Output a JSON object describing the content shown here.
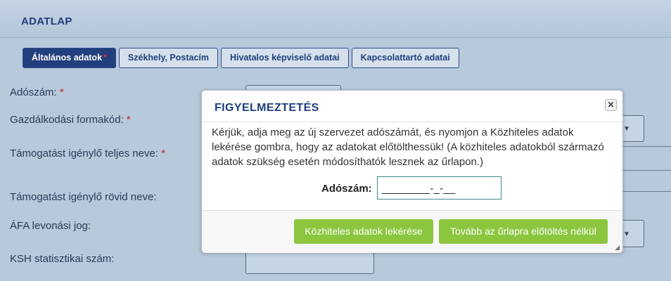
{
  "header": {
    "title": "ADATLAP"
  },
  "tabs": [
    {
      "label": "Általános adatok",
      "required": "*"
    },
    {
      "label": "Székhely, Postacím"
    },
    {
      "label": "Hivatalos képviselő adatai"
    },
    {
      "label": "Kapcsolattartó adatai"
    }
  ],
  "form": {
    "required_mark": "*",
    "fields": [
      {
        "label": "Adószám:"
      },
      {
        "label": "Gazdálkodási formakód:"
      },
      {
        "label": "Támogatást igénylő teljes neve:"
      },
      {
        "label": "Támogatást igénylő rövid neve:"
      },
      {
        "label": "ÁFA levonási jog:"
      },
      {
        "label": "KSH statisztikai szám:"
      }
    ]
  },
  "modal": {
    "title": "FIGYELMEZTETÉS",
    "close_icon": "close-icon",
    "message": "Kérjük, adja meg az új szervezet adószámát, és nyomjon a Közhiteles adatok lekérése gombra, hogy az adatokat előtölthessük! (A közhiteles adatokból származó adatok szükség esetén módosíthatók lesznek az űrlapon.)",
    "tax_label": "Adószám:",
    "tax_value": "",
    "tax_mask": "________-_-__",
    "buttons": {
      "fetch": "Közhiteles adatok lekérése",
      "skip": "Tovább az űrlapra előtöltés nélkül"
    }
  },
  "colors": {
    "accent": "#213f7c",
    "button_green": "#8cc63f",
    "required": "#c81e1e"
  }
}
